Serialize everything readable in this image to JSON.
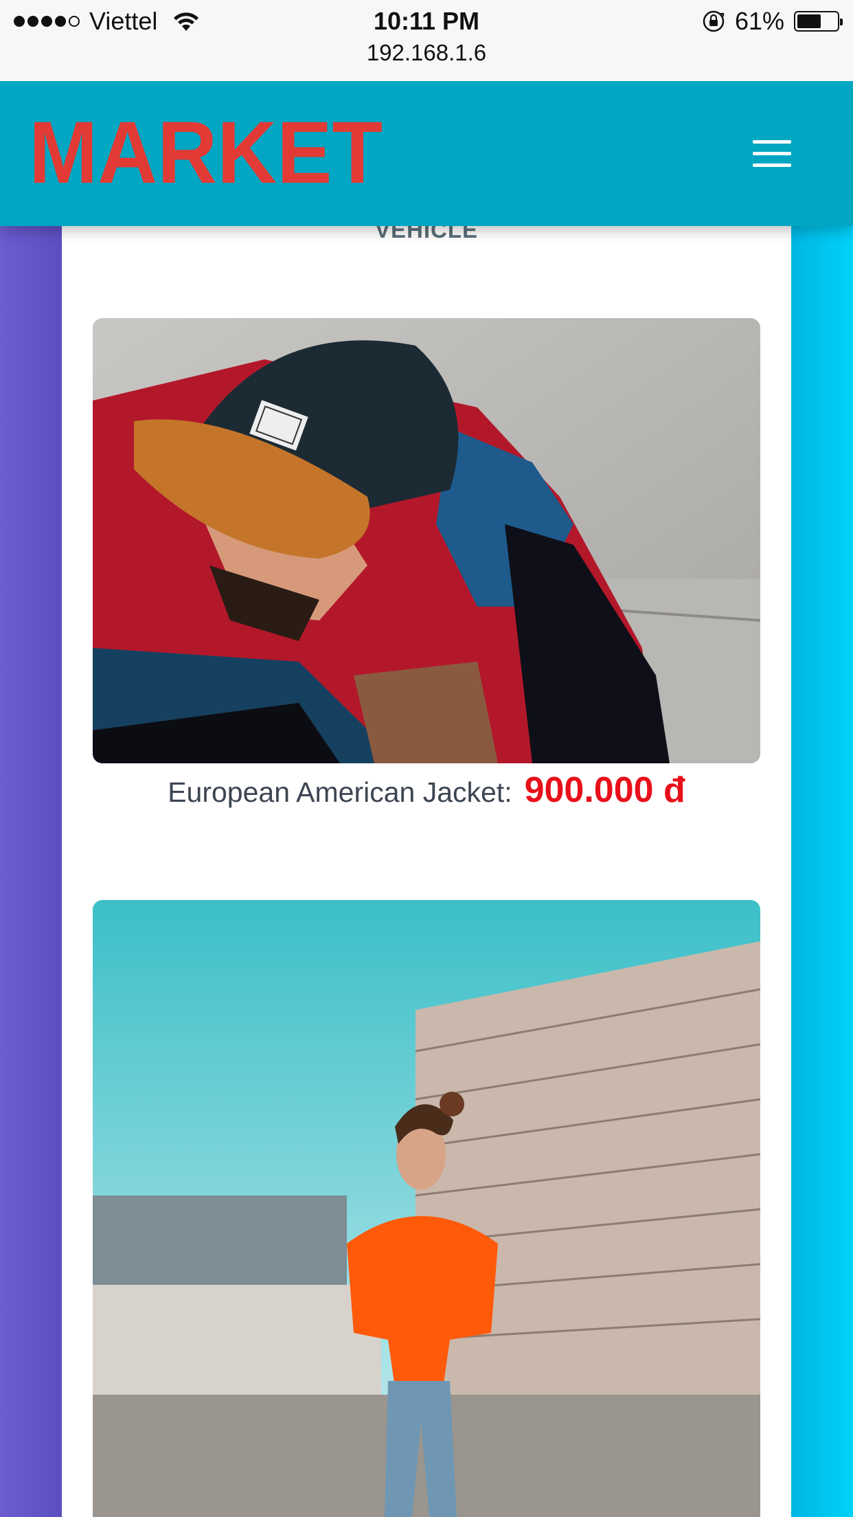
{
  "status_bar": {
    "carrier": "Viettel",
    "signal_bars_filled": 4,
    "signal_bars_total": 5,
    "time": "10:11 PM",
    "battery_percent": "61%",
    "battery_level": 0.61,
    "url": "192.168.1.6"
  },
  "header": {
    "logo_text": "MARKET",
    "menu_icon": "hamburger-menu-icon"
  },
  "section": {
    "title": "VEHICLE"
  },
  "products": [
    {
      "name": "European American Jacket:",
      "price": "900.000 đ"
    }
  ],
  "colors": {
    "header_bg": "#00a6c2",
    "logo": "#e23a35",
    "price": "#e8101a",
    "left_band": "#6a5acd",
    "right_band": "#00d2fb"
  }
}
